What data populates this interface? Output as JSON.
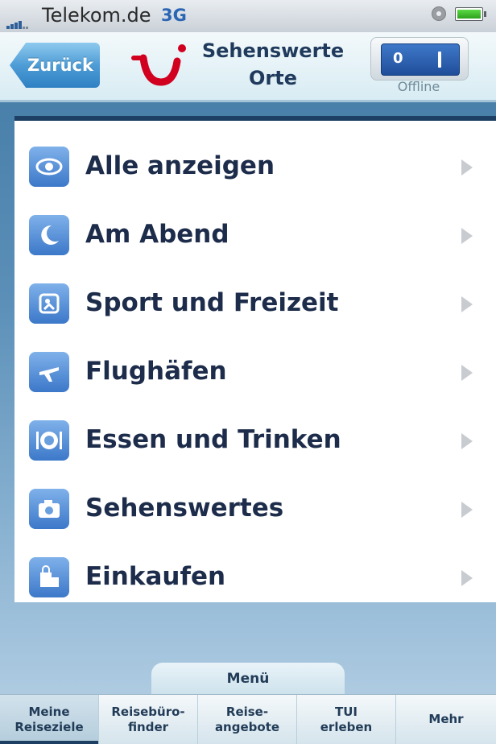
{
  "status_bar": {
    "carrier": "Telekom.de",
    "network": "3G"
  },
  "nav": {
    "back_label": "Zurück",
    "title_line1": "Sehenswerte",
    "title_line2": "Orte",
    "toggle_on_label": "0",
    "offline_label": "Offline"
  },
  "list": {
    "items": [
      {
        "label": "Alle anzeigen",
        "icon": "eye-icon"
      },
      {
        "label": "Am Abend",
        "icon": "moon-icon"
      },
      {
        "label": "Sport und Freizeit",
        "icon": "sport-icon"
      },
      {
        "label": "Flughäfen",
        "icon": "airplane-icon"
      },
      {
        "label": "Essen und Trinken",
        "icon": "plate-icon"
      },
      {
        "label": "Sehenswertes",
        "icon": "camera-icon"
      },
      {
        "label": "Einkaufen",
        "icon": "shopping-icon"
      }
    ]
  },
  "menu_label": "Menü",
  "tabbar": {
    "tabs": [
      {
        "label1": "Meine",
        "label2": "Reiseziele"
      },
      {
        "label1": "Reisebüro-",
        "label2": "finder"
      },
      {
        "label1": "Reise-",
        "label2": "angebote"
      },
      {
        "label1": "TUI",
        "label2": "erleben"
      },
      {
        "label1": "Mehr",
        "label2": ""
      }
    ]
  },
  "colors": {
    "accent": "#2e80c3",
    "brand_red": "#d1001f",
    "navy": "#1d3f63"
  }
}
